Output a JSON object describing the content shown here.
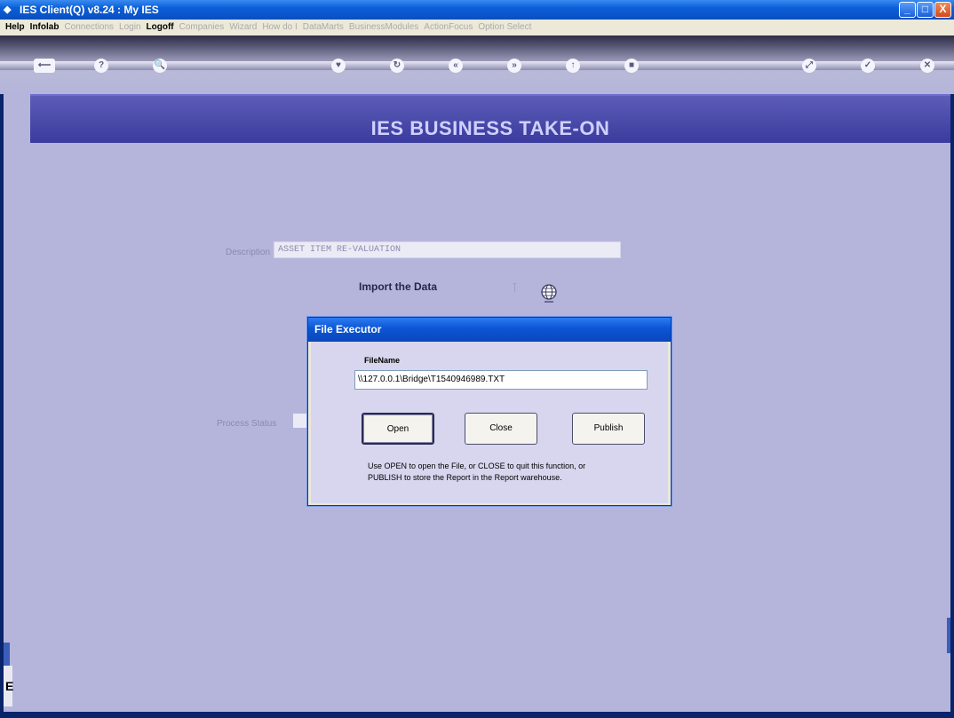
{
  "window": {
    "title": "IES Client(Q) v8.24 : My IES",
    "minimize": "_",
    "maximize": "□",
    "close": "X"
  },
  "menu": [
    {
      "label": "Help",
      "on": true
    },
    {
      "label": "Infolab",
      "on": true
    },
    {
      "label": "Connections",
      "on": false
    },
    {
      "label": "Login",
      "on": false
    },
    {
      "label": "Logoff",
      "on": true
    },
    {
      "label": "Companies",
      "on": false
    },
    {
      "label": "Wizard",
      "on": false
    },
    {
      "label": "How do I",
      "on": false
    },
    {
      "label": "DataMarts",
      "on": false
    },
    {
      "label": "BusinessModules",
      "on": false
    },
    {
      "label": "ActionFocus",
      "on": false
    },
    {
      "label": "Option Select",
      "on": false
    }
  ],
  "toolbar": {
    "arrow": "⟵",
    "help": "?",
    "search": "🔍",
    "heart": "♥",
    "refresh": "↻",
    "back": "«",
    "forward": "»",
    "up": "↑",
    "stop": "■",
    "fullscreen": "⤢",
    "ok": "✓",
    "close": "✕"
  },
  "banner": {
    "title": "IES BUSINESS TAKE-ON"
  },
  "form": {
    "description_label": "Description",
    "description_value": "ASSET ITEM RE-VALUATION",
    "import_label": "Import the Data",
    "process_label": "Process Status"
  },
  "dialog": {
    "title": "File Executor",
    "filename_label": "FileName",
    "filename_value": "\\\\127.0.0.1\\Bridge\\T1540946989.TXT",
    "open": "Open",
    "close": "Close",
    "publish": "Publish",
    "help_line1": "Use OPEN to open the File, or CLOSE to quit this function, or",
    "help_line2": "PUBLISH to store the Report in the Report warehouse."
  }
}
